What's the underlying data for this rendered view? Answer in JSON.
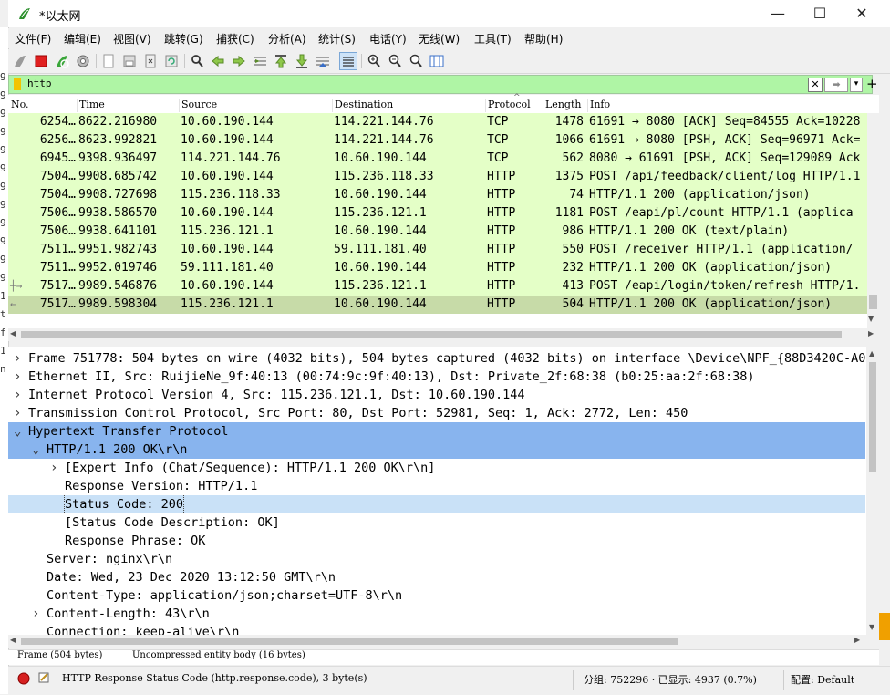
{
  "window": {
    "title": "*以太网",
    "minimize": "—",
    "maximize": "☐",
    "close": "✕"
  },
  "left_strip": [
    "9",
    "9",
    "9",
    "9",
    "9",
    "9",
    "9",
    "9",
    "9",
    "9",
    "9",
    "9",
    "1",
    "t",
    "f",
    "1",
    "n"
  ],
  "menu": [
    "文件(F)",
    "编辑(E)",
    "视图(V)",
    "跳转(G)",
    "捕获(C)",
    "分析(A)",
    "统计(S)",
    "电话(Y)",
    "无线(W)",
    "工具(T)",
    "帮助(H)"
  ],
  "toolbar": {
    "icons": [
      "shark-fin-start-icon",
      "stop-icon",
      "restart-icon",
      "options-gear-icon",
      "open-file-icon",
      "save-file-icon",
      "close-file-icon",
      "reload-icon",
      "find-packet-icon",
      "go-back-icon",
      "go-forward-icon",
      "go-to-packet-icon",
      "first-packet-icon",
      "last-packet-icon",
      "auto-scroll-icon",
      "colorize-icon",
      "zoom-in-icon",
      "zoom-out-icon",
      "zoom-reset-icon",
      "resize-columns-icon"
    ]
  },
  "filter": {
    "value": "http",
    "add_button": "+"
  },
  "packet_list": {
    "columns": [
      "No.",
      "Time",
      "Source",
      "Destination",
      "Protocol",
      "Length",
      "Info"
    ],
    "rows": [
      {
        "no": "6254…",
        "time": "8622.216980",
        "src": "10.60.190.144",
        "dst": "114.221.144.76",
        "proto": "TCP",
        "len": "1478",
        "info": "61691 → 8080 [ACK] Seq=84555 Ack=10228"
      },
      {
        "no": "6256…",
        "time": "8623.992821",
        "src": "10.60.190.144",
        "dst": "114.221.144.76",
        "proto": "TCP",
        "len": "1066",
        "info": "61691 → 8080 [PSH, ACK] Seq=96971 Ack="
      },
      {
        "no": "6945…",
        "time": "9398.936497",
        "src": "114.221.144.76",
        "dst": "10.60.190.144",
        "proto": "TCP",
        "len": "562",
        "info": "8080 → 61691 [PSH, ACK] Seq=129089 Ack"
      },
      {
        "no": "7504…",
        "time": "9908.685742",
        "src": "10.60.190.144",
        "dst": "115.236.118.33",
        "proto": "HTTP",
        "len": "1375",
        "info": "POST /api/feedback/client/log HTTP/1.1"
      },
      {
        "no": "7504…",
        "time": "9908.727698",
        "src": "115.236.118.33",
        "dst": "10.60.190.144",
        "proto": "HTTP",
        "len": "74",
        "info": "HTTP/1.1 200   (application/json)"
      },
      {
        "no": "7506…",
        "time": "9938.586570",
        "src": "10.60.190.144",
        "dst": "115.236.121.1",
        "proto": "HTTP",
        "len": "1181",
        "info": "POST /eapi/pl/count HTTP/1.1  (applica"
      },
      {
        "no": "7506…",
        "time": "9938.641101",
        "src": "115.236.121.1",
        "dst": "10.60.190.144",
        "proto": "HTTP",
        "len": "986",
        "info": "HTTP/1.1 200 OK  (text/plain)"
      },
      {
        "no": "7511…",
        "time": "9951.982743",
        "src": "10.60.190.144",
        "dst": "59.111.181.40",
        "proto": "HTTP",
        "len": "550",
        "info": "POST /receiver HTTP/1.1  (application/"
      },
      {
        "no": "7511…",
        "time": "9952.019746",
        "src": "59.111.181.40",
        "dst": "10.60.190.144",
        "proto": "HTTP",
        "len": "232",
        "info": "HTTP/1.1 200 OK  (application/json)"
      },
      {
        "no": "7517…",
        "time": "9989.546876",
        "src": "10.60.190.144",
        "dst": "115.236.121.1",
        "proto": "HTTP",
        "len": "413",
        "info": "POST /eapi/login/token/refresh HTTP/1."
      },
      {
        "no": "7517…",
        "time": "9989.598304",
        "src": "115.236.121.1",
        "dst": "10.60.190.144",
        "proto": "HTTP",
        "len": "504",
        "info": "HTTP/1.1 200 OK  (application/json)"
      }
    ]
  },
  "details": [
    {
      "indent": 0,
      "arrow": "›",
      "text": "Frame 751778: 504 bytes on wire (4032 bits), 504 bytes captured (4032 bits) on interface \\Device\\NPF_{88D3420C-A01B"
    },
    {
      "indent": 0,
      "arrow": "›",
      "text": "Ethernet II, Src: RuijieNe_9f:40:13 (00:74:9c:9f:40:13), Dst: Private_2f:68:38 (b0:25:aa:2f:68:38)"
    },
    {
      "indent": 0,
      "arrow": "›",
      "text": "Internet Protocol Version 4, Src: 115.236.121.1, Dst: 10.60.190.144"
    },
    {
      "indent": 0,
      "arrow": "›",
      "text": "Transmission Control Protocol, Src Port: 80, Dst Port: 52981, Seq: 1, Ack: 2772, Len: 450"
    },
    {
      "indent": 0,
      "arrow": "⌄",
      "text": "Hypertext Transfer Protocol"
    },
    {
      "indent": 1,
      "arrow": "⌄",
      "text": "HTTP/1.1 200 OK\\r\\n"
    },
    {
      "indent": 2,
      "arrow": "›",
      "text": "[Expert Info (Chat/Sequence): HTTP/1.1 200 OK\\r\\n]"
    },
    {
      "indent": 2,
      "arrow": "",
      "text": "Response Version: HTTP/1.1"
    },
    {
      "indent": 2,
      "arrow": "",
      "text": "Status Code: 200"
    },
    {
      "indent": 2,
      "arrow": "",
      "text": "[Status Code Description: OK]"
    },
    {
      "indent": 2,
      "arrow": "",
      "text": "Response Phrase: OK"
    },
    {
      "indent": 1,
      "arrow": "",
      "text": "Server: nginx\\r\\n"
    },
    {
      "indent": 1,
      "arrow": "",
      "text": "Date: Wed, 23 Dec 2020 13:12:50 GMT\\r\\n"
    },
    {
      "indent": 1,
      "arrow": "",
      "text": "Content-Type: application/json;charset=UTF-8\\r\\n"
    },
    {
      "indent": 1,
      "arrow": "›",
      "text": "Content-Length: 43\\r\\n"
    },
    {
      "indent": 1,
      "arrow": "",
      "text": "Connection: keep-alive\\r\\n"
    }
  ],
  "bytes_tabs": [
    "Frame (504 bytes)",
    "Uncompressed entity body (16 bytes)"
  ],
  "status": {
    "field": "HTTP Response Status Code (http.response.code), 3 byte(s)",
    "packets": "分组: 752296 · 已显示: 4937 (0.7%)",
    "profile": "配置: Default"
  },
  "colors": {
    "row_bg": "#e4ffc7",
    "row_selected": "#c7dba8",
    "filter_bg": "#aff5a5",
    "tree_selected": "#88b4ee",
    "tree_field_selected": "#c9e1f7"
  }
}
